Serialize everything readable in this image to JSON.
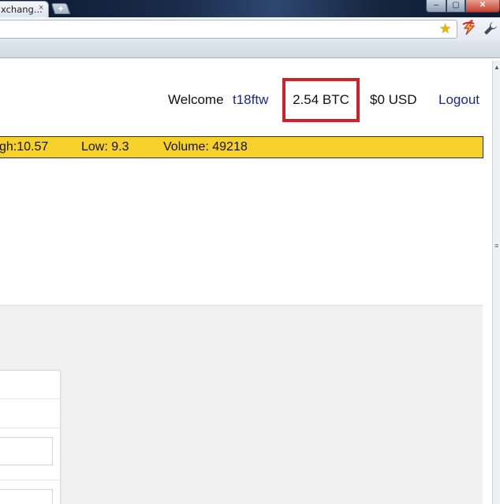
{
  "browser": {
    "tab_title": "xchang...",
    "tab_close": "×",
    "new_tab": "+",
    "window_controls": {
      "minimize": "–",
      "maximize": "▢",
      "close": "✕"
    },
    "icons": [
      "star-icon",
      "extension-bolt-icon",
      "wrench-icon"
    ]
  },
  "header": {
    "welcome": "Welcome",
    "username": "t18ftw",
    "btc_balance": "2.54 BTC",
    "usd_balance": "$0 USD",
    "logout": "Logout"
  },
  "ticker": {
    "high": "gh:10.57",
    "low": "Low: 9.3",
    "volume": "Volume: 49218"
  },
  "colors": {
    "ticker_bg": "#f5d12a",
    "highlight_border": "#d0202a",
    "link": "#1a2a8a",
    "panel_bg": "#f1f1f1"
  }
}
